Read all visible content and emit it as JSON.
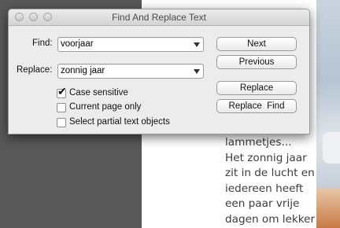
{
  "dialog": {
    "title": "Find And Replace Text",
    "find_label": "Find:",
    "find_value": "voorjaar",
    "replace_label": "Replace:",
    "replace_value": "zonnig jaar",
    "options": [
      {
        "label": "Case sensitive",
        "checked": true
      },
      {
        "label": "Current page only",
        "checked": false
      },
      {
        "label": "Select partial text objects",
        "checked": false
      }
    ],
    "buttons": {
      "next": "Next",
      "previous": "Previous",
      "replace": "Replace",
      "replace_find": "Replace  Find"
    }
  },
  "document": {
    "lines": [
      "lammetjes...",
      "Het zonnig jaar",
      "zit in de lucht en",
      "iedereen heeft",
      "een paar vrije",
      "dagen om lekker"
    ]
  },
  "icons": {
    "dropdown": "chevron-down-icon",
    "check": "checkmark-icon"
  }
}
